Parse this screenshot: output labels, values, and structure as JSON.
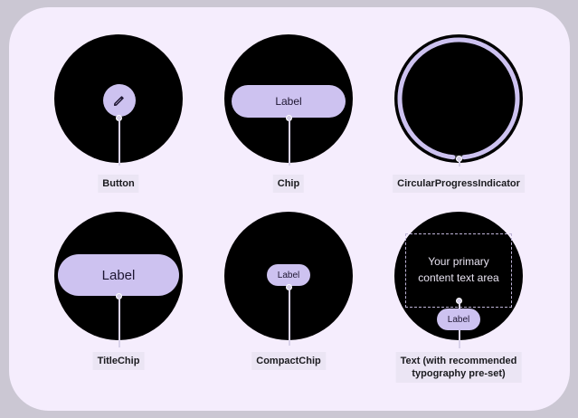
{
  "components": {
    "button": {
      "caption": "Button",
      "icon": "edit-icon"
    },
    "chip": {
      "caption": "Chip",
      "label": "Label"
    },
    "progress": {
      "caption": "CircularProgressIndicator",
      "progress_fraction": 0.97
    },
    "title_chip": {
      "caption": "TitleChip",
      "label": "Label"
    },
    "compact_chip": {
      "caption": "CompactChip",
      "label": "Label"
    },
    "text": {
      "caption_line1": "Text (with recommended",
      "caption_line2": "typography pre-set)",
      "content_line1": "Your primary",
      "content_line2": "content text area",
      "chip_label": "Label"
    }
  },
  "colors": {
    "background": "#f5edfd",
    "watch_face": "#000000",
    "chip_fill": "#cdc2f0",
    "progress_track": "#2f2f33",
    "progress_indicator": "#cdc2f0",
    "caption_bg": "#ebe5f4"
  }
}
